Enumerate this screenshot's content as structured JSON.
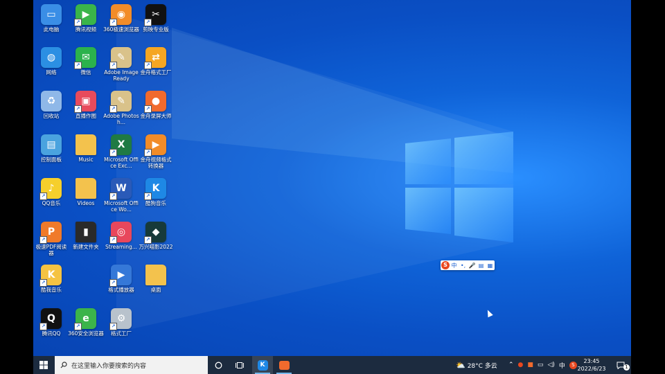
{
  "desktop": {
    "icons": [
      {
        "label": "此电脑",
        "icon": "computer-icon",
        "color": "#3a8ee6",
        "glyph": "▭"
      },
      {
        "label": "腾讯视频",
        "icon": "tencent-video-icon",
        "color": "#3ab54a",
        "glyph": "▶"
      },
      {
        "label": "360极速浏览器",
        "icon": "360-speed-browser-icon",
        "color": "#f28c28",
        "glyph": "◉"
      },
      {
        "label": "剪映专业版",
        "icon": "capcut-icon",
        "color": "#111111",
        "glyph": "✂"
      },
      {
        "label": "网络",
        "icon": "network-icon",
        "color": "#2b8fe3",
        "glyph": "◍"
      },
      {
        "label": "微信",
        "icon": "wechat-icon",
        "color": "#2bb24c",
        "glyph": "✉"
      },
      {
        "label": "Adobe ImageReady",
        "icon": "imageready-icon",
        "color": "#d9c28a",
        "glyph": "✎"
      },
      {
        "label": "金舟格式工厂",
        "icon": "jinzhou-format-icon",
        "color": "#f5a623",
        "glyph": "⇄"
      },
      {
        "label": "回收站",
        "icon": "recycle-bin-icon",
        "color": "#8fb8e8",
        "glyph": "♻"
      },
      {
        "label": "直播作图",
        "icon": "live-draw-icon",
        "color": "#e84b5c",
        "glyph": "▣"
      },
      {
        "label": "Adobe Photosh...",
        "icon": "photoshop-icon",
        "color": "#d9c28a",
        "glyph": "✎"
      },
      {
        "label": "金舟录屏大师",
        "icon": "screen-recorder-icon",
        "color": "#f06a2d",
        "glyph": "●"
      },
      {
        "label": "控制面板",
        "icon": "control-panel-icon",
        "color": "#4aa3df",
        "glyph": "▤"
      },
      {
        "label": "Music",
        "icon": "music-folder-icon",
        "color": "#f3c24d",
        "glyph": ""
      },
      {
        "label": "Microsoft Office Exc...",
        "icon": "excel-icon",
        "color": "#1f7a44",
        "glyph": "X"
      },
      {
        "label": "金舟视频格式转换器",
        "icon": "video-converter-icon",
        "color": "#f28c28",
        "glyph": "▶"
      },
      {
        "label": "QQ音乐",
        "icon": "qq-music-icon",
        "color": "#f6cf2c",
        "glyph": "♪"
      },
      {
        "label": "Videos",
        "icon": "videos-folder-icon",
        "color": "#f3c24d",
        "glyph": ""
      },
      {
        "label": "Microsoft Office Wo...",
        "icon": "word-icon",
        "color": "#2a5ab8",
        "glyph": "W"
      },
      {
        "label": "酷狗音乐",
        "icon": "kugou-icon",
        "color": "#1e88e5",
        "glyph": "K"
      },
      {
        "label": "极速PDF阅读器",
        "icon": "pdf-reader-icon",
        "color": "#f07a2a",
        "glyph": "P"
      },
      {
        "label": "新建文件夹",
        "icon": "new-folder-icon",
        "color": "#2a2a2a",
        "glyph": "▮"
      },
      {
        "label": "Streaming...",
        "icon": "streaming-icon",
        "color": "#e8475c",
        "glyph": "◎"
      },
      {
        "label": "万兴喵影2022",
        "icon": "filmora-icon",
        "color": "#173a3a",
        "glyph": "◆"
      },
      {
        "label": "酷我音乐",
        "icon": "kuwo-icon",
        "color": "#f5c342",
        "glyph": "K"
      },
      {
        "label": "",
        "icon": "",
        "color": "",
        "glyph": ""
      },
      {
        "label": "格式播放器",
        "icon": "format-player-icon",
        "color": "#3578d8",
        "glyph": "▶"
      },
      {
        "label": "桌面",
        "icon": "desktop-folder-icon",
        "color": "#f3c24d",
        "glyph": ""
      },
      {
        "label": "腾讯QQ",
        "icon": "qq-icon",
        "color": "#111111",
        "glyph": "Q"
      },
      {
        "label": "360安全浏览器",
        "icon": "360-browser-icon",
        "color": "#3cb44a",
        "glyph": "e"
      },
      {
        "label": "格式工厂",
        "icon": "format-factory-icon",
        "color": "#b8c2cc",
        "glyph": "⚙"
      },
      {
        "label": "",
        "icon": "",
        "color": "",
        "glyph": ""
      }
    ]
  },
  "ime": {
    "lang": "中",
    "punct": "•,",
    "mic": "🎤",
    "kb": "▤",
    "grid": "▦"
  },
  "taskbar": {
    "search_placeholder": "在这里输入你要搜索的内容",
    "weather": "28°C 多云",
    "ime_lang": "中",
    "time": "23:45",
    "date": "2022/6/23",
    "notification_count": "1"
  },
  "colors": {
    "taskbar_bg": "#1c2b3f",
    "desktop_blue": "#0a4fc4",
    "accent": "#76b9ed"
  }
}
